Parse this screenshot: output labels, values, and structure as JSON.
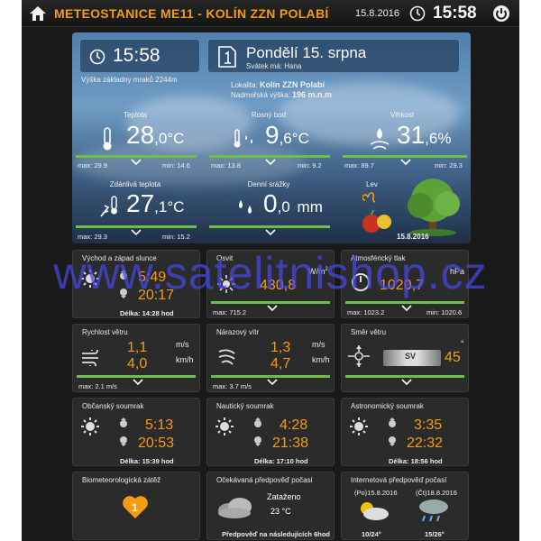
{
  "header": {
    "title": "METEOSTANICE ME11 - KOLÍN ZZN POLABÍ",
    "date": "15.8.2016",
    "time": "15:58"
  },
  "hero": {
    "time": "15:58",
    "cloud_base": "Výška základny mraků 2244m",
    "day": "Pondělí 15. srpna",
    "nameday": "Svátek má: Hana",
    "location_label": "Lokalita:",
    "location": "Kolín ZZN Polabí",
    "altitude_label": "Nadmořská výška:",
    "altitude": "196 m.n.m",
    "temperature": {
      "label": "Teplota",
      "int": "28",
      "dec": ",0",
      "unit": "°C",
      "max": "max: 29.9",
      "min": "min: 14.6"
    },
    "dewpoint": {
      "label": "Rosný bod",
      "int": "9",
      "dec": ",6",
      "unit": "°C",
      "max": "max: 13.8",
      "min": "min: 9.2"
    },
    "humidity": {
      "label": "Vlhkost",
      "int": "31",
      "dec": ",6",
      "unit": "%",
      "max": "max: 89.7",
      "min": "min: 29.3"
    },
    "apparent": {
      "label": "Zdánlivá teplota",
      "int": "27",
      "dec": ",1",
      "unit": "°C",
      "max": "max: 29.3",
      "min": "min: 15.2"
    },
    "rain": {
      "label": "Denní srážky",
      "int": "0",
      "dec": ",0",
      "unit": "mm"
    },
    "zodiac": {
      "name": "Lev",
      "date": "15.8.2016"
    }
  },
  "cards": {
    "sun": {
      "title": "Východ a západ slunce",
      "rise": "5:49",
      "set": "20:17",
      "foot": "Délka: 14:28 hod"
    },
    "light": {
      "title": "Osvit",
      "value": "430,8",
      "unit": "W/m",
      "unit_sup": "2",
      "foot": "max: 715.2"
    },
    "pressure": {
      "title": "Atmosférický tlak",
      "value": "1020,7",
      "unit": "hPa",
      "max": "max: 1023.2",
      "min": "min: 1020.6"
    },
    "wind": {
      "title": "Rychlost větru",
      "ms": "1,1",
      "kmh": "4,0",
      "unit1": "m/s",
      "unit2": "km/h",
      "foot": "max: 2.1 m/s"
    },
    "gust": {
      "title": "Nárazový vítr",
      "ms": "1,3",
      "kmh": "4,7",
      "unit1": "m/s",
      "unit2": "km/h",
      "foot": "max: 3.7 m/s"
    },
    "direction": {
      "title": "Směr větru",
      "value": "45",
      "deg": "°",
      "compass": "SV"
    },
    "civil": {
      "title": "Občanský soumrak",
      "rise": "5:13",
      "set": "20:53",
      "foot": "Délka: 15:39 hod"
    },
    "nautical": {
      "title": "Nautický soumrak",
      "rise": "4:28",
      "set": "21:38",
      "foot": "Délka: 17:10 hod"
    },
    "astro": {
      "title": "Astronomický soumrak",
      "rise": "3:35",
      "set": "22:32",
      "foot": "Délka: 18:56 hod"
    },
    "bio": {
      "title": "Biometeorologická zátěž",
      "value": "1"
    },
    "forecast": {
      "title": "Očekávaná předpověď počasí",
      "cond": "Zataženo",
      "temp": "23 °C",
      "foot": "Předpověď na následujících 6hod"
    },
    "internet": {
      "title": "Internetová předpověď počasí",
      "d1": "(Po)15.8.2016",
      "d2": "(Čt)18.8.2016",
      "t1": "10/24°",
      "t2": "15/26°"
    }
  },
  "watermark": "www.satelitnishop.cz",
  "colors": {
    "accent": "#f39c12",
    "green": "#6cc04a",
    "bg": "#1a1a1a"
  }
}
